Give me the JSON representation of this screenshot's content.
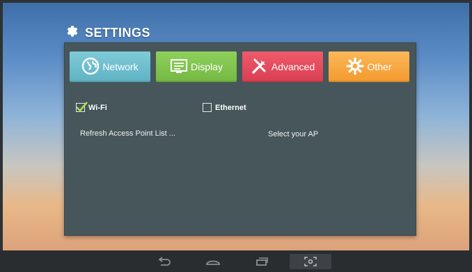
{
  "header": {
    "title": "SETTINGS",
    "icon": "gear-icon"
  },
  "tabs": [
    {
      "label": "Network",
      "icon": "globe-icon",
      "color": "#62b6c8"
    },
    {
      "label": "Display",
      "icon": "display-icon",
      "color": "#78bc47"
    },
    {
      "label": "Advanced",
      "icon": "tools-icon",
      "color": "#de4356"
    },
    {
      "label": "Other",
      "icon": "gear-icon",
      "color": "#f5a13a"
    }
  ],
  "network": {
    "wifi": {
      "label": "Wi-Fi",
      "checked": true
    },
    "ethernet": {
      "label": "Ethernet",
      "checked": false
    },
    "refresh_label": "Refresh Access Point List ...",
    "select_ap_label": "Select your AP"
  },
  "navbar": {
    "buttons": [
      "back-icon",
      "home-icon",
      "recent-apps-icon",
      "screenshot-icon"
    ]
  }
}
